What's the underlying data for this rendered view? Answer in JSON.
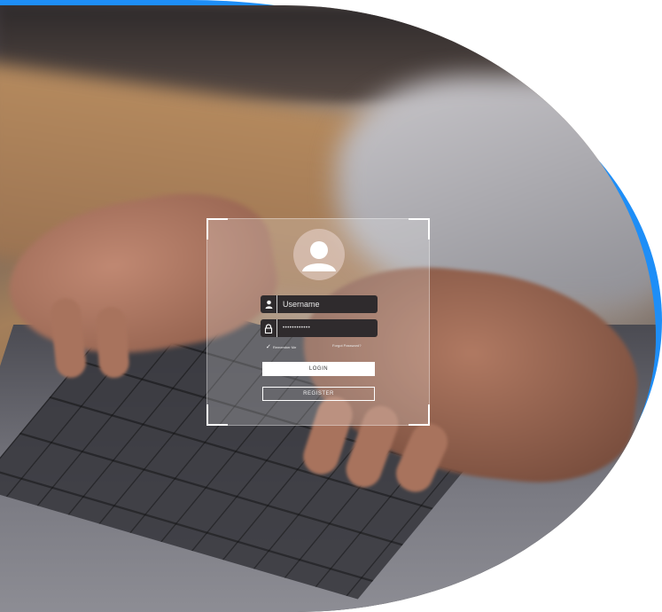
{
  "colors": {
    "accent_blue": "#1e8ef7",
    "field_bg": "#2f2b2d",
    "button_bg": "#ffffff"
  },
  "login": {
    "avatar_icon": "user-avatar-icon",
    "username_icon": "user-icon",
    "password_icon": "lock-icon",
    "username_value": "Username",
    "password_value": "••••••••••••",
    "remember_label": "Remember Me",
    "forgot_label": "Forgot Password?",
    "login_label": "LOGIN",
    "register_label": "REGISTER"
  }
}
